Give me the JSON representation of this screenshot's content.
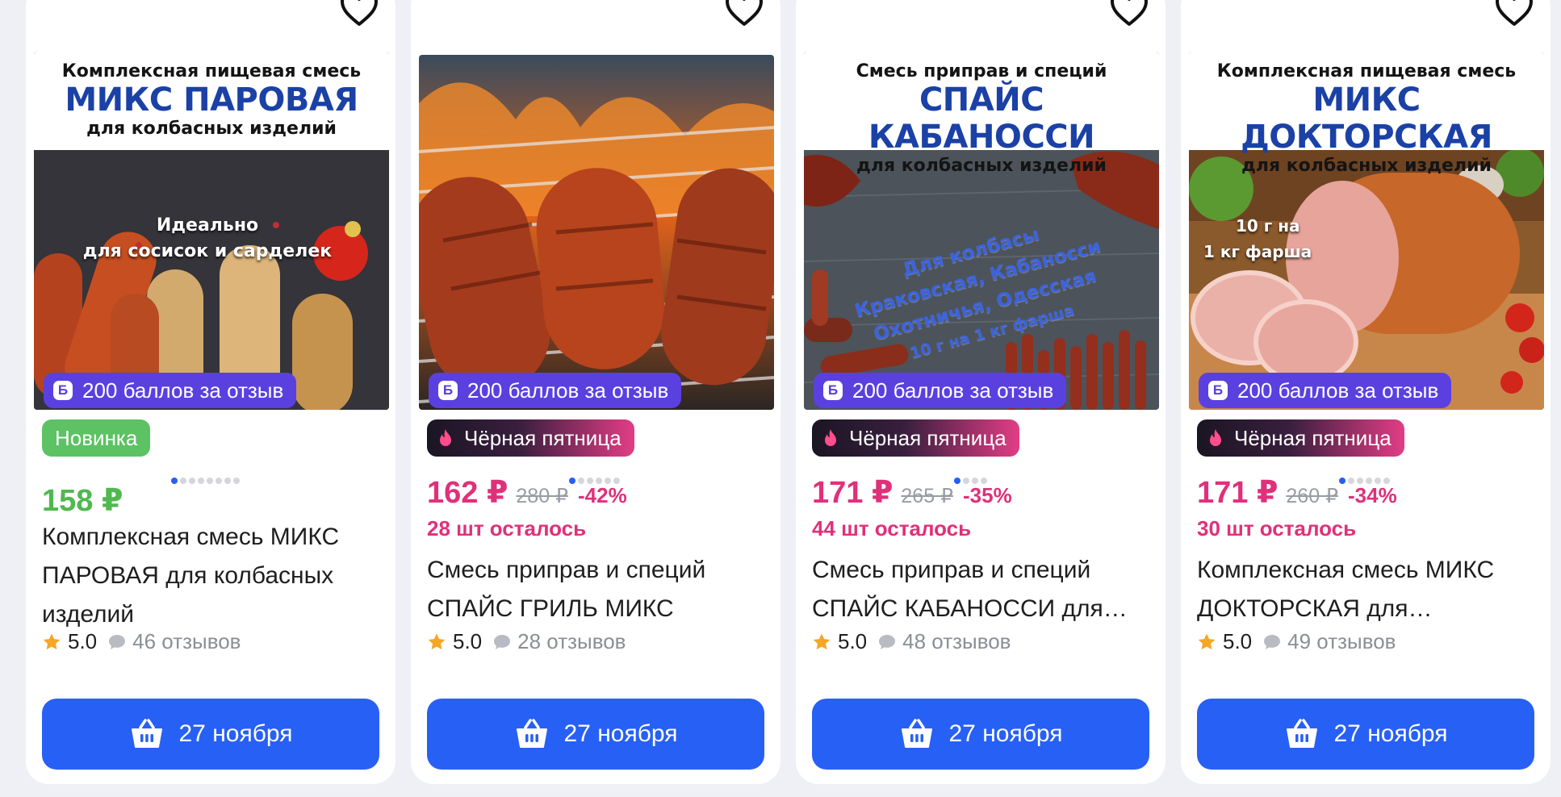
{
  "cards": [
    {
      "banner": {
        "line1": "Комплексная пищевая смесь",
        "line2": "МИКС ПАРОВАЯ",
        "line3": "для колбасных изделий"
      },
      "photo_caption": [
        "Идеально",
        "для сосисок и сарделек"
      ],
      "points": "200 баллов за отзыв",
      "points_icon": "Б",
      "tag": "Новинка",
      "price": "158 ₽",
      "old_price": "",
      "discount": "",
      "stock": "",
      "title_line1": "Комплексная смесь МИКС",
      "title_line2": "ПАРОВАЯ для колбасных",
      "title_line3": "изделий",
      "rating": "5.0",
      "reviews": "46 отзывов",
      "delivery": "27 ноября"
    },
    {
      "banner": {
        "line1": "",
        "line2": "",
        "line3": ""
      },
      "photo_caption": [],
      "points": "200 баллов за отзыв",
      "points_icon": "Б",
      "tag": "Чёрная пятница",
      "price": "162 ₽",
      "old_price": "280 ₽",
      "discount": "-42%",
      "stock": "28 шт осталось",
      "title_line1": "Смесь приправ и специй",
      "title_line2": "СПАЙС ГРИЛЬ МИКС",
      "rating": "5.0",
      "reviews": "28 отзывов",
      "delivery": "27 ноября"
    },
    {
      "banner": {
        "line1": "Смесь приправ и специй",
        "line2": "СПАЙС КАБАНОССИ",
        "line3": "для колбасных изделий"
      },
      "photo_caption": [
        "Для колбасы",
        "Краковская, Кабаносси",
        "Охотничья, Одесская",
        "10 г на 1 кг фарша"
      ],
      "points": "200 баллов за отзыв",
      "points_icon": "Б",
      "tag": "Чёрная пятница",
      "price": "171 ₽",
      "old_price": "265 ₽",
      "discount": "-35%",
      "stock": "44 шт осталось",
      "title_line1": "Смесь приправ и специй",
      "title_line2": "СПАЙС КАБАНОССИ для…",
      "rating": "5.0",
      "reviews": "48 отзывов",
      "delivery": "27 ноября"
    },
    {
      "banner": {
        "line1": "Комплексная пищевая смесь",
        "line2": "МИКС ДОКТОРСКАЯ",
        "line3": "для колбасных изделий"
      },
      "photo_caption": [
        "10 г на",
        "1 кг фарша"
      ],
      "points": "200 баллов за отзыв",
      "points_icon": "Б",
      "tag": "Чёрная пятница",
      "price": "171 ₽",
      "old_price": "260 ₽",
      "discount": "-34%",
      "stock": "30 шт осталось",
      "title_line1": "Комплексная смесь МИКС",
      "title_line2": "ДОКТОРСКАЯ для…",
      "rating": "5.0",
      "reviews": "49 отзывов",
      "delivery": "27 ноября"
    }
  ],
  "colors": {
    "accent": "#2760f5",
    "sale": "#e0307a",
    "new": "#5cc263",
    "points": "#5b40e0"
  },
  "icons": {
    "favorite": "heart-icon",
    "cart": "basket-icon",
    "rating": "star-icon",
    "reviews": "comment-icon",
    "hot": "fire-icon"
  }
}
